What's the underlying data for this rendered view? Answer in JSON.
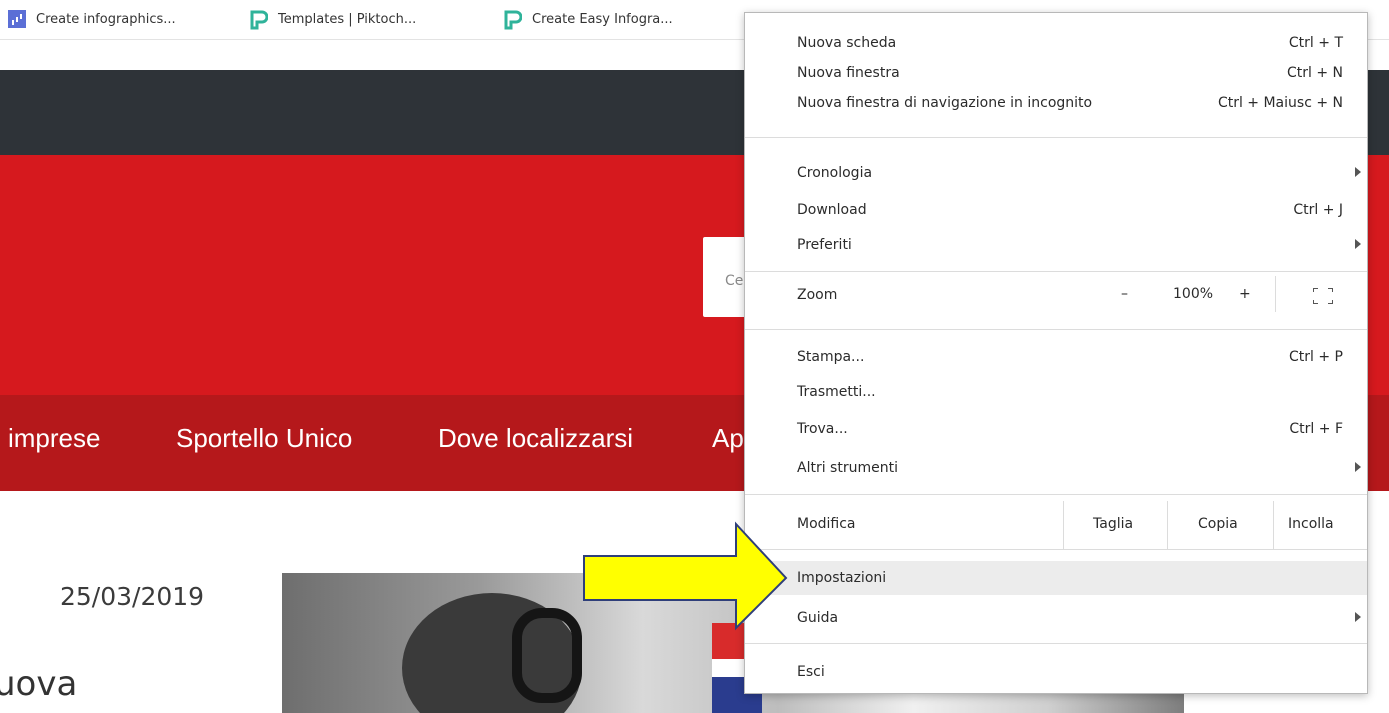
{
  "bookmarks": [
    {
      "label": "Create infographics...",
      "icon": "bar-chart-icon"
    },
    {
      "label": "Templates | Piktoch...",
      "icon": "piktochart-icon"
    },
    {
      "label": "Create Easy Infogra...",
      "icon": "piktochart-icon"
    }
  ],
  "site": {
    "search_placeholder": "Ce",
    "nav": [
      "imprese",
      "Sportello Unico",
      "Dove localizzarsi",
      "Ap"
    ],
    "date": "25/03/2019",
    "teaser": "uova"
  },
  "menu": {
    "new_tab": {
      "label": "Nuova scheda",
      "shortcut": "Ctrl + T"
    },
    "new_window": {
      "label": "Nuova finestra",
      "shortcut": "Ctrl + N"
    },
    "incognito": {
      "label": "Nuova finestra di navigazione in incognito",
      "shortcut": "Ctrl + Maiusc + N"
    },
    "history": {
      "label": "Cronologia"
    },
    "downloads": {
      "label": "Download",
      "shortcut": "Ctrl + J"
    },
    "bookmarks": {
      "label": "Preferiti"
    },
    "zoom": {
      "label": "Zoom",
      "minus": "–",
      "value": "100%",
      "plus": "+"
    },
    "print": {
      "label": "Stampa...",
      "shortcut": "Ctrl + P"
    },
    "cast": {
      "label": "Trasmetti..."
    },
    "find": {
      "label": "Trova...",
      "shortcut": "Ctrl + F"
    },
    "more_tools": {
      "label": "Altri strumenti"
    },
    "edit": {
      "label": "Modifica",
      "cut": "Taglia",
      "copy": "Copia",
      "paste": "Incolla"
    },
    "settings": {
      "label": "Impostazioni"
    },
    "help": {
      "label": "Guida"
    },
    "exit": {
      "label": "Esci"
    }
  },
  "colors": {
    "header_dark": "#2e3338",
    "banner_red": "#d6191e",
    "nav_red": "#b5181b",
    "arrow_fill": "#ffff00",
    "arrow_stroke": "#2f3f7a",
    "menu_highlight": "#ececec"
  }
}
